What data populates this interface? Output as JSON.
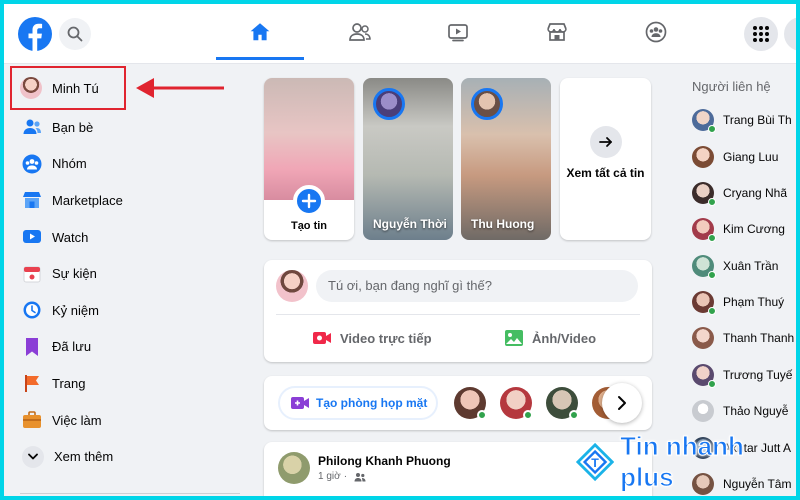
{
  "colors": {
    "brand": "#1877f2",
    "frame": "#00d5e8",
    "highlight": "#e0242f",
    "online": "#31a24c"
  },
  "topnav": {
    "tabs": [
      {
        "icon": "home-icon",
        "active": true
      },
      {
        "icon": "friends-icon",
        "active": false
      },
      {
        "icon": "watch-icon",
        "active": false
      },
      {
        "icon": "marketplace-icon",
        "active": false
      },
      {
        "icon": "groups-icon",
        "active": false
      }
    ]
  },
  "sidebar": {
    "profile": {
      "label": "Minh Tú"
    },
    "items": [
      {
        "label": "Bạn bè",
        "icon": "friends-icon"
      },
      {
        "label": "Nhóm",
        "icon": "groups-icon"
      },
      {
        "label": "Marketplace",
        "icon": "marketplace-icon"
      },
      {
        "label": "Watch",
        "icon": "watch-icon"
      },
      {
        "label": "Sự kiện",
        "icon": "calendar-icon"
      },
      {
        "label": "Kỷ niệm",
        "icon": "clock-icon"
      },
      {
        "label": "Đã lưu",
        "icon": "bookmark-icon"
      },
      {
        "label": "Trang",
        "icon": "flag-icon"
      },
      {
        "label": "Việc làm",
        "icon": "briefcase-icon"
      }
    ],
    "more": {
      "label": "Xem thêm"
    }
  },
  "stories": {
    "create": {
      "label": "Tạo tin"
    },
    "users": [
      {
        "name": "Nguyễn Thời"
      },
      {
        "name": "Thu Huong"
      }
    ],
    "see_all": {
      "label": "Xem tất cả tin"
    }
  },
  "composer": {
    "placeholder": "Tú ơi, bạn đang nghĩ gì thế?",
    "actions": [
      {
        "label": "Video trực tiếp",
        "icon": "live-video-icon"
      },
      {
        "label": "Ảnh/Video",
        "icon": "photo-icon"
      }
    ]
  },
  "rooms": {
    "create_label": "Tạo phòng họp mặt"
  },
  "post": {
    "author": "Philong Khanh Phuong",
    "time": "1 giờ"
  },
  "contacts": {
    "title": "Người liên hệ",
    "list": [
      {
        "name": "Trang Bùi Th"
      },
      {
        "name": "Giang Luu"
      },
      {
        "name": "Cryang Nhã"
      },
      {
        "name": "Kim Cương"
      },
      {
        "name": "Xuân Trần"
      },
      {
        "name": "Phạm Thuý"
      },
      {
        "name": "Thanh Thanh"
      },
      {
        "name": "Trương Tuyế"
      },
      {
        "name": "Thảo Nguyễ"
      },
      {
        "name": "Akhtar Jutt A"
      },
      {
        "name": "Nguyễn Tâm"
      }
    ]
  },
  "watermark": {
    "text": "Tin nhanh plus"
  }
}
